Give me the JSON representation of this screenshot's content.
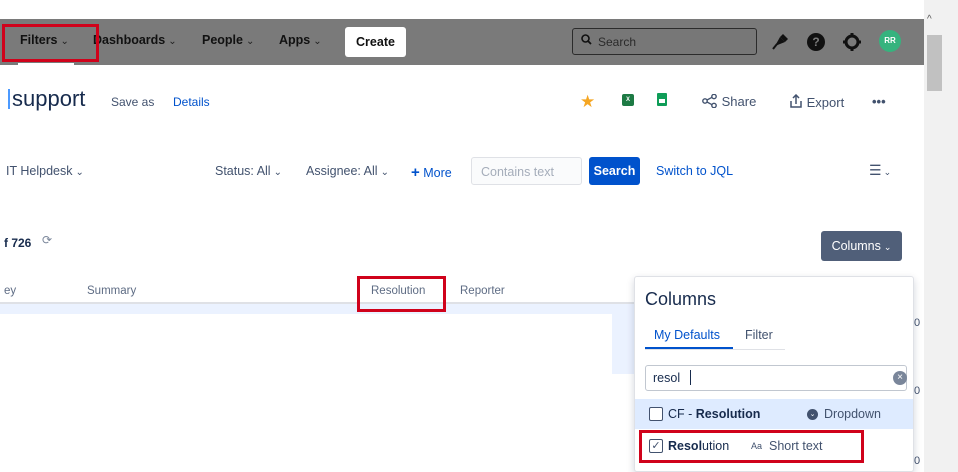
{
  "topnav": {
    "filters": "Filters",
    "dashboards": "Dashboards",
    "people": "People",
    "apps": "Apps",
    "create": "Create",
    "search_placeholder": "Search",
    "avatar_initials": "RR"
  },
  "title_row": {
    "title": "support",
    "save_as": "Save as",
    "details": "Details",
    "share": "Share",
    "export": "Export",
    "more_actions": "•••"
  },
  "filter_row": {
    "project": "IT Helpdesk",
    "status": "Status: All",
    "assignee": "Assignee: All",
    "more": "More",
    "contains_placeholder": "Contains text",
    "search": "Search",
    "switch_jql": "Switch to JQL"
  },
  "results": {
    "count": "f 726",
    "columns_button": "Columns"
  },
  "table": {
    "headers": {
      "key": "ey",
      "summary": "Summary",
      "resolution": "Resolution",
      "reporter": "Reporter"
    },
    "trailing": [
      "0",
      "0",
      "0"
    ]
  },
  "columns_panel": {
    "title": "Columns",
    "tabs": [
      "My Defaults",
      "Filter"
    ],
    "search_value": "resol",
    "options": [
      {
        "label_prefix": "CF - ",
        "label_bold": "Resolution",
        "type": "Dropdown",
        "checked": false
      },
      {
        "label_prefix": "",
        "label_bold": "Resol",
        "label_rest": "ution",
        "type_prefix": "Aa",
        "type": "Short text",
        "checked": true
      }
    ]
  },
  "colors": {
    "nav_bg": "#7a7a7a",
    "primary": "#0052cc",
    "highlight_red": "#d0021b",
    "avatar": "#36b37e",
    "star": "#f5a623"
  }
}
